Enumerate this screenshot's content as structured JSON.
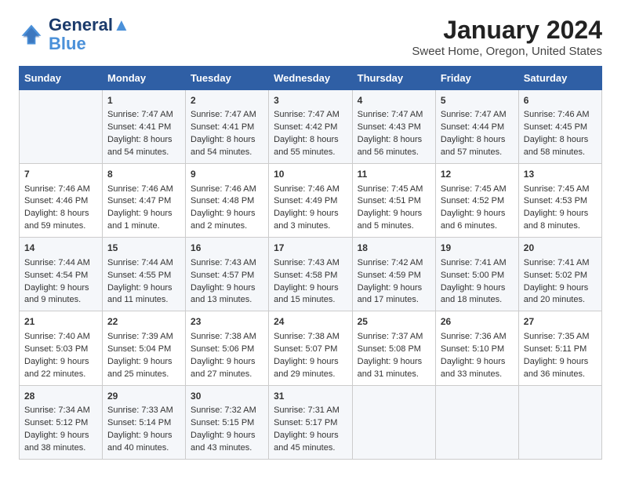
{
  "header": {
    "logo_line1": "General",
    "logo_line2": "Blue",
    "main_title": "January 2024",
    "subtitle": "Sweet Home, Oregon, United States"
  },
  "calendar": {
    "days_of_week": [
      "Sunday",
      "Monday",
      "Tuesday",
      "Wednesday",
      "Thursday",
      "Friday",
      "Saturday"
    ],
    "weeks": [
      [
        {
          "day": "",
          "content": ""
        },
        {
          "day": "1",
          "content": "Sunrise: 7:47 AM\nSunset: 4:41 PM\nDaylight: 8 hours\nand 54 minutes."
        },
        {
          "day": "2",
          "content": "Sunrise: 7:47 AM\nSunset: 4:41 PM\nDaylight: 8 hours\nand 54 minutes."
        },
        {
          "day": "3",
          "content": "Sunrise: 7:47 AM\nSunset: 4:42 PM\nDaylight: 8 hours\nand 55 minutes."
        },
        {
          "day": "4",
          "content": "Sunrise: 7:47 AM\nSunset: 4:43 PM\nDaylight: 8 hours\nand 56 minutes."
        },
        {
          "day": "5",
          "content": "Sunrise: 7:47 AM\nSunset: 4:44 PM\nDaylight: 8 hours\nand 57 minutes."
        },
        {
          "day": "6",
          "content": "Sunrise: 7:46 AM\nSunset: 4:45 PM\nDaylight: 8 hours\nand 58 minutes."
        }
      ],
      [
        {
          "day": "7",
          "content": "Sunrise: 7:46 AM\nSunset: 4:46 PM\nDaylight: 8 hours\nand 59 minutes."
        },
        {
          "day": "8",
          "content": "Sunrise: 7:46 AM\nSunset: 4:47 PM\nDaylight: 9 hours\nand 1 minute."
        },
        {
          "day": "9",
          "content": "Sunrise: 7:46 AM\nSunset: 4:48 PM\nDaylight: 9 hours\nand 2 minutes."
        },
        {
          "day": "10",
          "content": "Sunrise: 7:46 AM\nSunset: 4:49 PM\nDaylight: 9 hours\nand 3 minutes."
        },
        {
          "day": "11",
          "content": "Sunrise: 7:45 AM\nSunset: 4:51 PM\nDaylight: 9 hours\nand 5 minutes."
        },
        {
          "day": "12",
          "content": "Sunrise: 7:45 AM\nSunset: 4:52 PM\nDaylight: 9 hours\nand 6 minutes."
        },
        {
          "day": "13",
          "content": "Sunrise: 7:45 AM\nSunset: 4:53 PM\nDaylight: 9 hours\nand 8 minutes."
        }
      ],
      [
        {
          "day": "14",
          "content": "Sunrise: 7:44 AM\nSunset: 4:54 PM\nDaylight: 9 hours\nand 9 minutes."
        },
        {
          "day": "15",
          "content": "Sunrise: 7:44 AM\nSunset: 4:55 PM\nDaylight: 9 hours\nand 11 minutes."
        },
        {
          "day": "16",
          "content": "Sunrise: 7:43 AM\nSunset: 4:57 PM\nDaylight: 9 hours\nand 13 minutes."
        },
        {
          "day": "17",
          "content": "Sunrise: 7:43 AM\nSunset: 4:58 PM\nDaylight: 9 hours\nand 15 minutes."
        },
        {
          "day": "18",
          "content": "Sunrise: 7:42 AM\nSunset: 4:59 PM\nDaylight: 9 hours\nand 17 minutes."
        },
        {
          "day": "19",
          "content": "Sunrise: 7:41 AM\nSunset: 5:00 PM\nDaylight: 9 hours\nand 18 minutes."
        },
        {
          "day": "20",
          "content": "Sunrise: 7:41 AM\nSunset: 5:02 PM\nDaylight: 9 hours\nand 20 minutes."
        }
      ],
      [
        {
          "day": "21",
          "content": "Sunrise: 7:40 AM\nSunset: 5:03 PM\nDaylight: 9 hours\nand 22 minutes."
        },
        {
          "day": "22",
          "content": "Sunrise: 7:39 AM\nSunset: 5:04 PM\nDaylight: 9 hours\nand 25 minutes."
        },
        {
          "day": "23",
          "content": "Sunrise: 7:38 AM\nSunset: 5:06 PM\nDaylight: 9 hours\nand 27 minutes."
        },
        {
          "day": "24",
          "content": "Sunrise: 7:38 AM\nSunset: 5:07 PM\nDaylight: 9 hours\nand 29 minutes."
        },
        {
          "day": "25",
          "content": "Sunrise: 7:37 AM\nSunset: 5:08 PM\nDaylight: 9 hours\nand 31 minutes."
        },
        {
          "day": "26",
          "content": "Sunrise: 7:36 AM\nSunset: 5:10 PM\nDaylight: 9 hours\nand 33 minutes."
        },
        {
          "day": "27",
          "content": "Sunrise: 7:35 AM\nSunset: 5:11 PM\nDaylight: 9 hours\nand 36 minutes."
        }
      ],
      [
        {
          "day": "28",
          "content": "Sunrise: 7:34 AM\nSunset: 5:12 PM\nDaylight: 9 hours\nand 38 minutes."
        },
        {
          "day": "29",
          "content": "Sunrise: 7:33 AM\nSunset: 5:14 PM\nDaylight: 9 hours\nand 40 minutes."
        },
        {
          "day": "30",
          "content": "Sunrise: 7:32 AM\nSunset: 5:15 PM\nDaylight: 9 hours\nand 43 minutes."
        },
        {
          "day": "31",
          "content": "Sunrise: 7:31 AM\nSunset: 5:17 PM\nDaylight: 9 hours\nand 45 minutes."
        },
        {
          "day": "",
          "content": ""
        },
        {
          "day": "",
          "content": ""
        },
        {
          "day": "",
          "content": ""
        }
      ]
    ]
  }
}
